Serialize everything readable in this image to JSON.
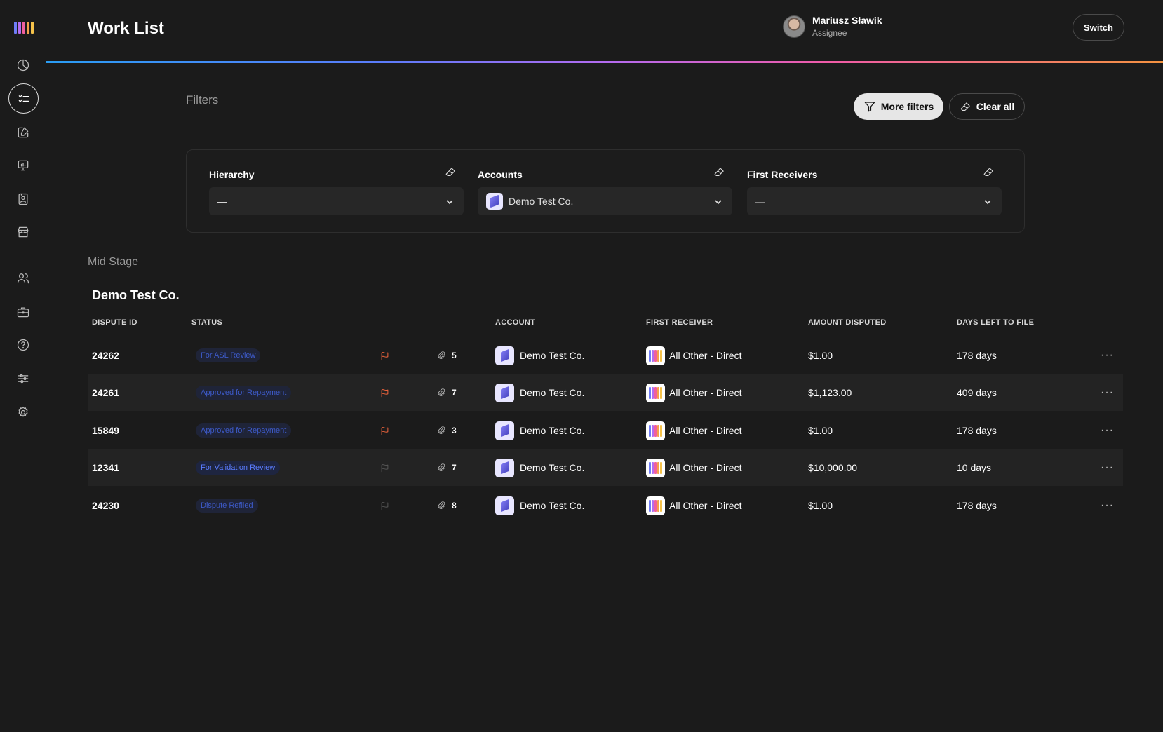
{
  "app": {
    "logo_colors": [
      "#6f7cf7",
      "#b46cf0",
      "#f0609d",
      "#f5a04a",
      "#f5c24a"
    ],
    "accent_gradient": [
      "#2a9df4",
      "#b36bf0",
      "#f05ba8",
      "#f59340"
    ]
  },
  "sidebar": {
    "items": [
      {
        "name": "dashboard-pie-icon",
        "active": false
      },
      {
        "name": "worklist-checklist-icon",
        "active": true
      },
      {
        "name": "edit-document-icon",
        "active": false
      },
      {
        "name": "reports-chart-icon",
        "active": false
      },
      {
        "name": "contacts-book-icon",
        "active": false
      },
      {
        "name": "store-icon",
        "active": false
      },
      {
        "name": "users-icon",
        "active": false
      },
      {
        "name": "briefcase-icon",
        "active": false
      },
      {
        "name": "help-icon",
        "active": false
      },
      {
        "name": "sliders-icon",
        "active": false
      },
      {
        "name": "settings-gear-icon",
        "active": false
      }
    ]
  },
  "header": {
    "title": "Work List",
    "user_name": "Mariusz Sławik",
    "user_role": "Assignee",
    "switch_label": "Switch"
  },
  "filters": {
    "title": "Filters",
    "more_filters_label": "More filters",
    "clear_all_label": "Clear all",
    "hierarchy": {
      "label": "Hierarchy",
      "value": "—"
    },
    "accounts": {
      "label": "Accounts",
      "value": "Demo Test Co."
    },
    "first_receivers": {
      "label": "First Receivers",
      "value": "—"
    }
  },
  "stage": {
    "label": "Mid Stage",
    "group_title": "Demo Test Co."
  },
  "table": {
    "columns": {
      "dispute_id": "DISPUTE ID",
      "status": "STATUS",
      "account": "ACCOUNT",
      "first_receiver": "FIRST RECEIVER",
      "amount_disputed": "AMOUNT DISPUTED",
      "days_left": "DAYS LEFT TO FILE"
    },
    "rows": [
      {
        "id": "24262",
        "status": "For ASL Review",
        "flagged": true,
        "attachments": "5",
        "account": "Demo Test Co.",
        "receiver": "All Other - Direct",
        "amount": "$1.00",
        "days": "178 days"
      },
      {
        "id": "24261",
        "status": "Approved for Repayment",
        "flagged": true,
        "attachments": "7",
        "account": "Demo Test Co.",
        "receiver": "All Other - Direct",
        "amount": "$1,123.00",
        "days": "409 days"
      },
      {
        "id": "15849",
        "status": "Approved for Repayment",
        "flagged": true,
        "attachments": "3",
        "account": "Demo Test Co.",
        "receiver": "All Other - Direct",
        "amount": "$1.00",
        "days": "178 days"
      },
      {
        "id": "12341",
        "status": "For Validation Review",
        "flagged": false,
        "attachments": "7",
        "account": "Demo Test Co.",
        "receiver": "All Other - Direct",
        "amount": "$10,000.00",
        "days": "10 days"
      },
      {
        "id": "24230",
        "status": "Dispute Refiled",
        "flagged": false,
        "attachments": "8",
        "account": "Demo Test Co.",
        "receiver": "All Other - Direct",
        "amount": "$1.00",
        "days": "178 days"
      }
    ],
    "flag_active_color": "#f0643c",
    "flag_inactive_color": "#555555",
    "more_actions_glyph": "···"
  }
}
